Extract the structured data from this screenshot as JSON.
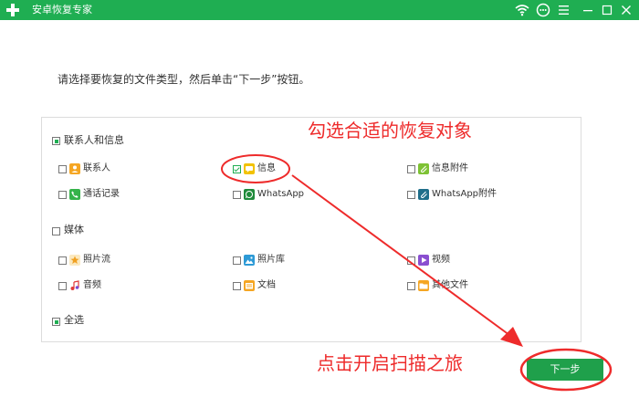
{
  "window": {
    "title": "安卓恢复专家",
    "icons": [
      "plus-logo-icon",
      "wifi-icon",
      "chat-icon",
      "menu-icon",
      "minimize-icon",
      "maximize-icon",
      "close-icon"
    ],
    "accent_color": "#1fae52"
  },
  "instruction": "请选择要恢复的文件类型，然后单击“下一步”按钮。",
  "groups": {
    "contacts": {
      "label": "联系人和信息",
      "state": "partial",
      "items": [
        {
          "label": "联系人",
          "checked": false,
          "icon": "contacts-icon"
        },
        {
          "label": "信息",
          "checked": true,
          "icon": "messages-icon"
        },
        {
          "label": "信息附件",
          "checked": false,
          "icon": "attachment-icon"
        },
        {
          "label": "通话记录",
          "checked": false,
          "icon": "call-log-icon"
        },
        {
          "label": "WhatsApp",
          "checked": false,
          "icon": "whatsapp-icon"
        },
        {
          "label": "WhatsApp附件",
          "checked": false,
          "icon": "whatsapp-attachment-icon"
        }
      ]
    },
    "media": {
      "label": "媒体",
      "state": "unchecked",
      "items": [
        {
          "label": "照片流",
          "checked": false,
          "icon": "photo-stream-icon"
        },
        {
          "label": "照片库",
          "checked": false,
          "icon": "photo-library-icon"
        },
        {
          "label": "视频",
          "checked": false,
          "icon": "video-icon"
        },
        {
          "label": "音频",
          "checked": false,
          "icon": "audio-icon"
        },
        {
          "label": "文档",
          "checked": false,
          "icon": "document-icon"
        },
        {
          "label": "其他文件",
          "checked": false,
          "icon": "folder-icon"
        }
      ]
    }
  },
  "select_all": {
    "label": "全选",
    "state": "partial"
  },
  "next_button": {
    "label": "下一步"
  },
  "annotations": {
    "top": "勾选合适的恢复对象",
    "bottom": "点击开启扫描之旅",
    "color": "#ee2b2b"
  }
}
